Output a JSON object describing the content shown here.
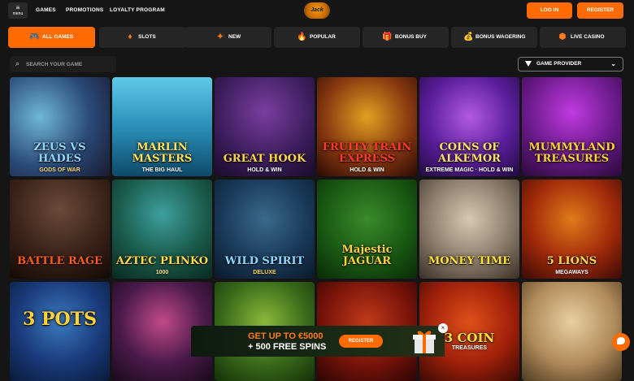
{
  "header": {
    "menu_label": "menu",
    "nav": [
      "GAMES",
      "PROMOTIONS",
      "LOYALTY PROGRAM"
    ],
    "logo_text": "Jack",
    "login_label": "LOG IN",
    "register_label": "REGISTER"
  },
  "categories": [
    {
      "label": "ALL GAMES",
      "icon": "gamepad-icon"
    },
    {
      "label": "SLOTS",
      "icon": "diamond-icon"
    },
    {
      "label": "NEW",
      "icon": "sparkle-icon"
    },
    {
      "label": "POPULAR",
      "icon": "flame-icon"
    },
    {
      "label": "BONUS BUY",
      "icon": "gift-icon"
    },
    {
      "label": "BONUS WAGERING",
      "icon": "money-bag-icon"
    },
    {
      "label": "LIVE CASINO",
      "icon": "cube-icon"
    }
  ],
  "search": {
    "placeholder": "SEARCH YOUR GAME"
  },
  "provider": {
    "label": "GAME PROVIDER"
  },
  "games": [
    {
      "title": "ZEUS VS HADES",
      "subtitle": "GODS OF WAR"
    },
    {
      "title": "MARLIN MASTERS",
      "subtitle": "THE BIG HAUL"
    },
    {
      "title": "GREAT HOOK",
      "subtitle": "HOLD & WIN"
    },
    {
      "title": "FRUITY TRAIN EXPRESS",
      "subtitle": "HOLD & WIN"
    },
    {
      "title": "COINS OF ALKEMOR",
      "subtitle": "EXTREME MAGIC · HOLD & WIN"
    },
    {
      "title": "MUMMYLAND TREASURES",
      "subtitle": ""
    },
    {
      "title": "BATTLE RAGE",
      "subtitle": ""
    },
    {
      "title": "AZTEC PLINKO",
      "subtitle": "1000"
    },
    {
      "title": "WILD SPIRIT",
      "subtitle": "DELUXE"
    },
    {
      "title": "Majestic JAGUAR",
      "subtitle": ""
    },
    {
      "title": "MONEY TIME",
      "subtitle": ""
    },
    {
      "title": "5 LIONS",
      "subtitle": "MEGAWAYS"
    },
    {
      "title": "3 POTS",
      "subtitle": ""
    },
    {
      "title": "",
      "subtitle": ""
    },
    {
      "title": "",
      "subtitle": ""
    },
    {
      "title": "",
      "subtitle": ""
    },
    {
      "title": "3 COIN",
      "subtitle": "TREASURES"
    },
    {
      "title": "",
      "subtitle": ""
    }
  ],
  "promo": {
    "line1": "GET UP TO €5000",
    "line2": "+ 500 FREE SPINS",
    "register_label": "REGISTER"
  },
  "colors": {
    "accent": "#ff6b00",
    "background": "#151515"
  }
}
